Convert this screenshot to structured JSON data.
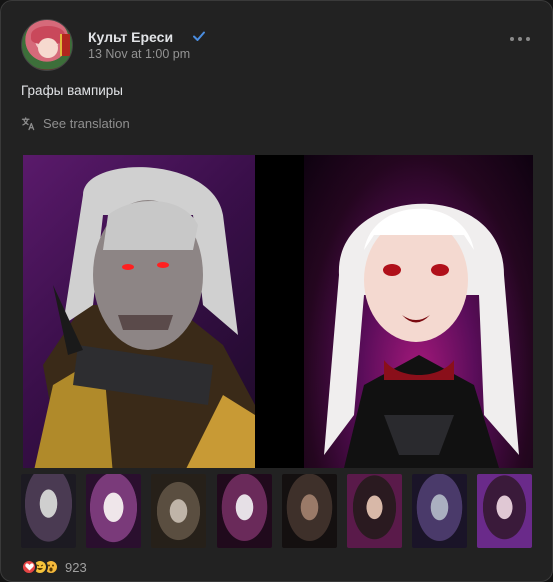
{
  "post": {
    "author": "Культ Ереси",
    "date": "13 Nov at 1:00 pm",
    "text": "Графы вампиры",
    "translate_label": "See translation"
  },
  "reactions": {
    "count": "923",
    "types": [
      "heart-icon",
      "laughing-face-icon",
      "surprised-face-icon"
    ]
  },
  "colors": {
    "card_bg": "#222222",
    "verified": "#4a8de0",
    "muted_text": "#939393",
    "heart": "#e64646"
  },
  "photos": {
    "main": [
      "undead-vampire-count-illustration",
      "anime-vampire-countess-illustration"
    ],
    "thumbnail_count": 8
  }
}
